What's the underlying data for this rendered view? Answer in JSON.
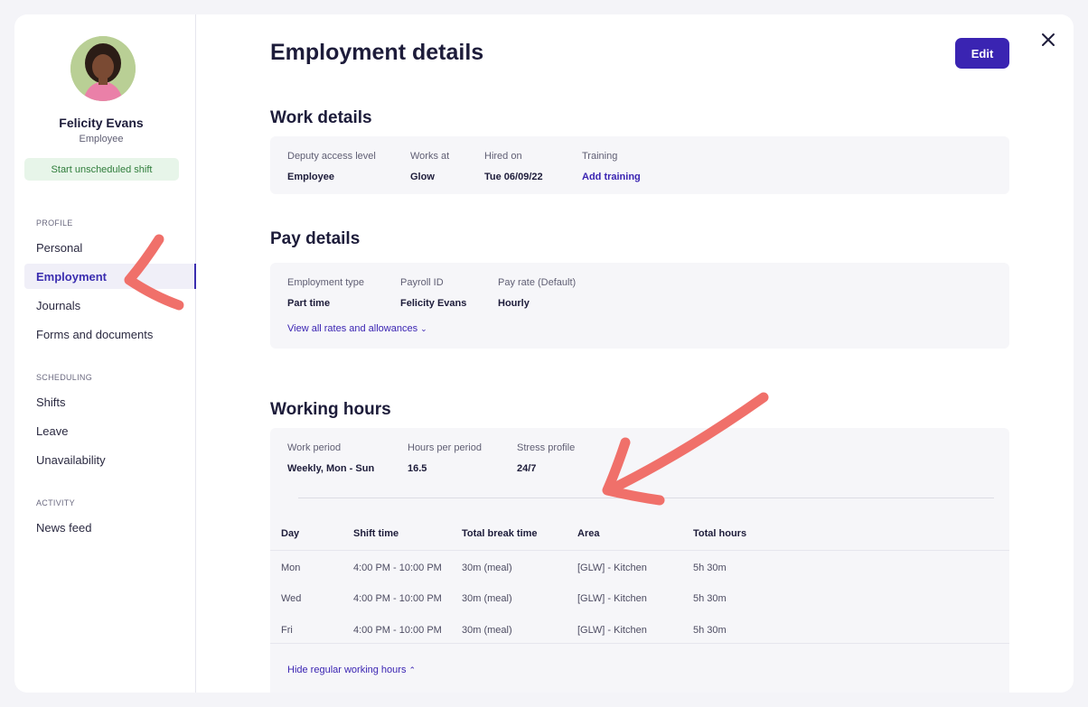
{
  "profile": {
    "name": "Felicity Evans",
    "role": "Employee",
    "start_shift_label": "Start unscheduled shift"
  },
  "sidebar": {
    "sections": [
      {
        "title": "PROFILE",
        "items": [
          "Personal",
          "Employment",
          "Journals",
          "Forms and documents"
        ]
      },
      {
        "title": "SCHEDULING",
        "items": [
          "Shifts",
          "Leave",
          "Unavailability"
        ]
      },
      {
        "title": "ACTIVITY",
        "items": [
          "News feed"
        ]
      }
    ],
    "active_item": "Employment"
  },
  "page": {
    "title": "Employment details",
    "edit_label": "Edit"
  },
  "work_details": {
    "title": "Work details",
    "fields": [
      {
        "label": "Deputy access level",
        "value": "Employee"
      },
      {
        "label": "Works at",
        "value": "Glow"
      },
      {
        "label": "Hired on",
        "value": "Tue 06/09/22"
      },
      {
        "label": "Training",
        "value": "Add training"
      }
    ]
  },
  "pay_details": {
    "title": "Pay details",
    "fields": [
      {
        "label": "Employment type",
        "value": "Part time"
      },
      {
        "label": "Payroll ID",
        "value": "Felicity Evans"
      },
      {
        "label": "Pay rate (Default)",
        "value": "Hourly"
      }
    ],
    "view_rates_label": "View all rates and allowances"
  },
  "working_hours": {
    "title": "Working hours",
    "fields": [
      {
        "label": "Work period",
        "value": "Weekly, Mon - Sun"
      },
      {
        "label": "Hours per period",
        "value": "16.5"
      },
      {
        "label": "Stress profile",
        "value": "24/7"
      }
    ],
    "columns": [
      "Day",
      "Shift time",
      "Total break time",
      "Area",
      "Total hours"
    ],
    "rows": [
      [
        "Mon",
        "4:00 PM - 10:00 PM",
        "30m (meal)",
        "[GLW] - Kitchen",
        "5h 30m"
      ],
      [
        "Wed",
        "4:00 PM - 10:00 PM",
        "30m (meal)",
        "[GLW] - Kitchen",
        "5h 30m"
      ],
      [
        "Fri",
        "4:00 PM - 10:00 PM",
        "30m (meal)",
        "[GLW] - Kitchen",
        "5h 30m"
      ]
    ],
    "hide_label": "Hide regular working hours"
  },
  "colors": {
    "accent": "#3a24b2",
    "annotation_arrow": "#f0706a",
    "start_shift_bg": "#e7f5e9"
  },
  "icons": {
    "close": "close-icon",
    "chevron_down": "chevron-down-icon",
    "chevron_up": "chevron-up-icon"
  }
}
